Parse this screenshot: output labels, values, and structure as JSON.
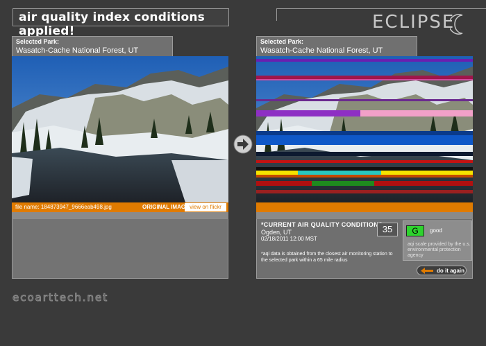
{
  "header": {
    "banner": "air quality index conditions applied!",
    "logo_text": "ECLIPSE",
    "logo_icon": "crescent-moon-icon"
  },
  "left_panel": {
    "park_label": "Selected Park:",
    "park_name": "Wasatch-Cache National Forest, UT",
    "file_name": "file name: 184873947_9666eab498.jpg",
    "image_label": "ORIGINAL IMAGE",
    "flickr_button": "view on flickr"
  },
  "right_panel": {
    "park_label": "Selected Park:",
    "park_name": "Wasatch-Cache National Forest, UT",
    "aqi_title": "*CURRENT AIR QUALITY CONDITIONS",
    "city": "Ogden, UT",
    "datetime": "02/18/2011 12:00 MST",
    "aqi_value": "35",
    "note": "*aqi data is obtained from the closest air monitoring station to the selected park within a 65 mile radius",
    "grade": "G",
    "grade_word": "good",
    "scale_note": "aqi scale provided by the u.s. environmental protection agency",
    "again_button": "do it again"
  },
  "footer": {
    "site": "ecoarttech.net"
  },
  "colors": {
    "accent": "#e07b00",
    "good": "#2ed32e",
    "background": "#3a3a3a"
  }
}
